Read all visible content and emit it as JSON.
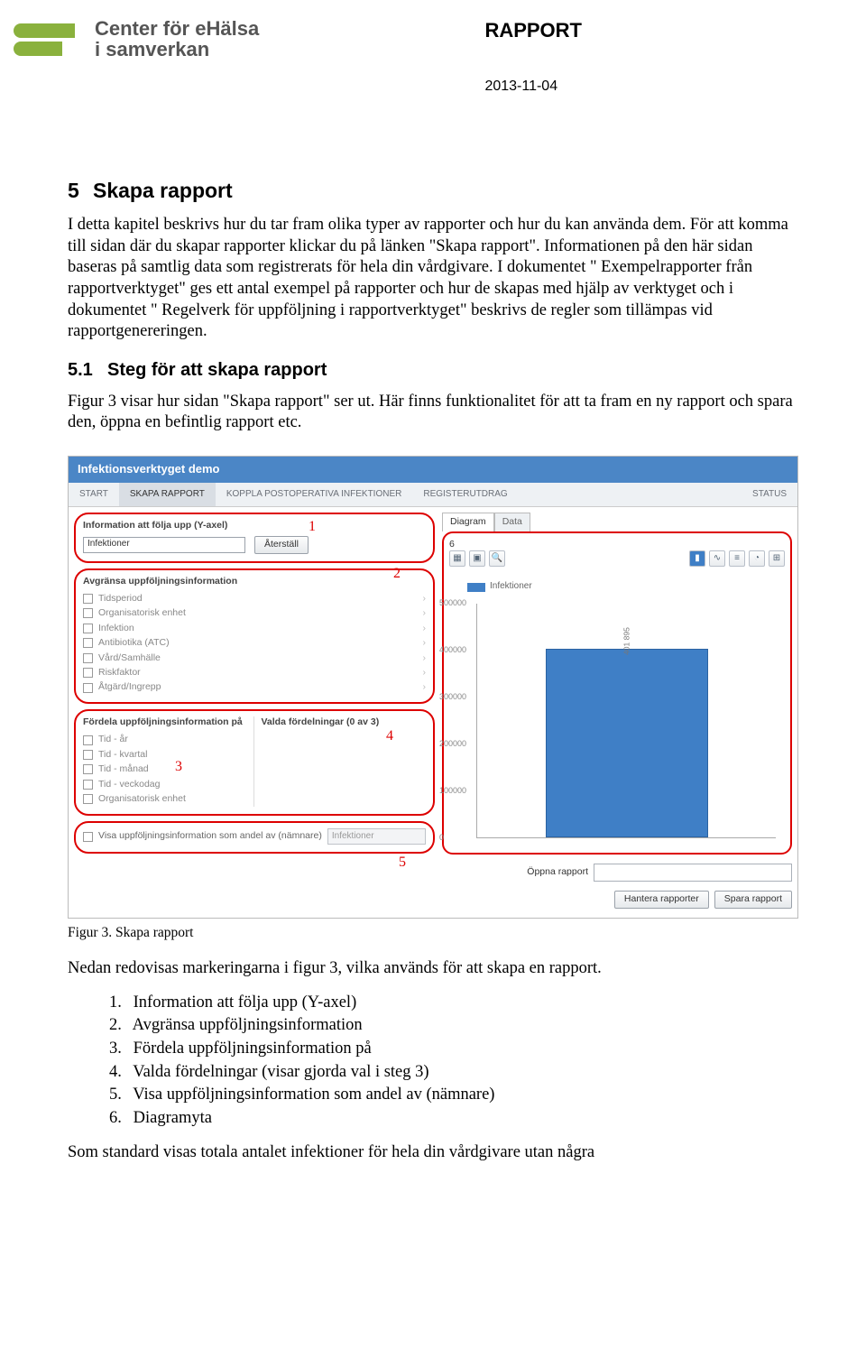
{
  "header": {
    "org_line1": "Center för eHälsa",
    "org_line2": "i samverkan",
    "doc_type": "RAPPORT",
    "date": "2013-11-04"
  },
  "section": {
    "num": "5",
    "title": "Skapa rapport",
    "p1": "I detta kapitel beskrivs hur du tar fram olika typer av rapporter och hur du kan använda dem. För att komma till sidan där du skapar rapporter klickar du på länken \"Skapa rapport\". Informationen på den här sidan baseras på samtlig data som registrerats för hela din vårdgivare. I dokumentet \" Exempelrapporter från rapportverktyget\" ges ett antal exempel på rapporter och hur de skapas med hjälp av verktyget och i dokumentet \" Regelverk för uppföljning i rapportverktyget\" beskrivs de regler som tillämpas vid rapportgenereringen.",
    "sub_num": "5.1",
    "sub_title": "Steg för att skapa rapport",
    "p2": "Figur 3 visar hur sidan \"Skapa rapport\" ser ut. Här finns funktionalitet för att ta fram en ny rapport och spara den, öppna en befintlig rapport etc."
  },
  "screenshot": {
    "app_title": "Infektionsverktyget demo",
    "tabs": [
      "START",
      "SKAPA RAPPORT",
      "KOPPLA POSTOPERATIVA INFEKTIONER",
      "REGISTERUTDRAG"
    ],
    "tab_right": "STATUS",
    "panel1": {
      "header": "Information att följa upp (Y-axel)",
      "value": "Infektioner",
      "reset": "Återställ"
    },
    "panel2": {
      "header": "Avgränsa uppföljningsinformation",
      "items": [
        "Tidsperiod",
        "Organisatorisk enhet",
        "Infektion",
        "Antibiotika (ATC)",
        "Vård/Samhälle",
        "Riskfaktor",
        "Åtgärd/Ingrepp"
      ]
    },
    "panel3": {
      "header_left": "Fördela uppföljningsinformation på",
      "items_left": [
        "Tid - år",
        "Tid - kvartal",
        "Tid - månad",
        "Tid - veckodag",
        "Organisatorisk enhet"
      ],
      "header_right": "Valda fördelningar (0 av 3)"
    },
    "panel5": {
      "label": "Visa uppföljningsinformation som andel av (nämnare)",
      "value": "Infektioner"
    },
    "diagram": {
      "tabs": [
        "Diagram",
        "Data"
      ],
      "legend": "Infektioner",
      "bar_label": "401 895"
    },
    "footer": {
      "open_label": "Öppna rapport",
      "manage": "Hantera rapporter",
      "save": "Spara rapport"
    },
    "annotations": {
      "a1": "1",
      "a2": "2",
      "a3": "3",
      "a4": "4",
      "a5": "5",
      "a6": "6"
    }
  },
  "chart_data": {
    "type": "bar",
    "categories": [
      ""
    ],
    "values": [
      401895
    ],
    "title": "",
    "xlabel": "",
    "ylabel": "",
    "ylim": [
      0,
      500000
    ],
    "yticks": [
      0,
      100000,
      200000,
      300000,
      400000,
      500000
    ],
    "series": [
      {
        "name": "Infektioner",
        "values": [
          401895
        ]
      }
    ]
  },
  "caption": "Figur 3. Skapa rapport",
  "after": {
    "p3": "Nedan redovisas markeringarna i figur 3, vilka används för att skapa en rapport.",
    "list": [
      "Information att följa upp (Y-axel)",
      "Avgränsa uppföljningsinformation",
      "Fördela uppföljningsinformation på",
      "Valda fördelningar (visar gjorda val i steg 3)",
      "Visa uppföljningsinformation som andel av (nämnare)",
      "Diagramyta"
    ],
    "p4": "Som standard visas totala antalet infektioner för hela din vårdgivare utan några"
  }
}
